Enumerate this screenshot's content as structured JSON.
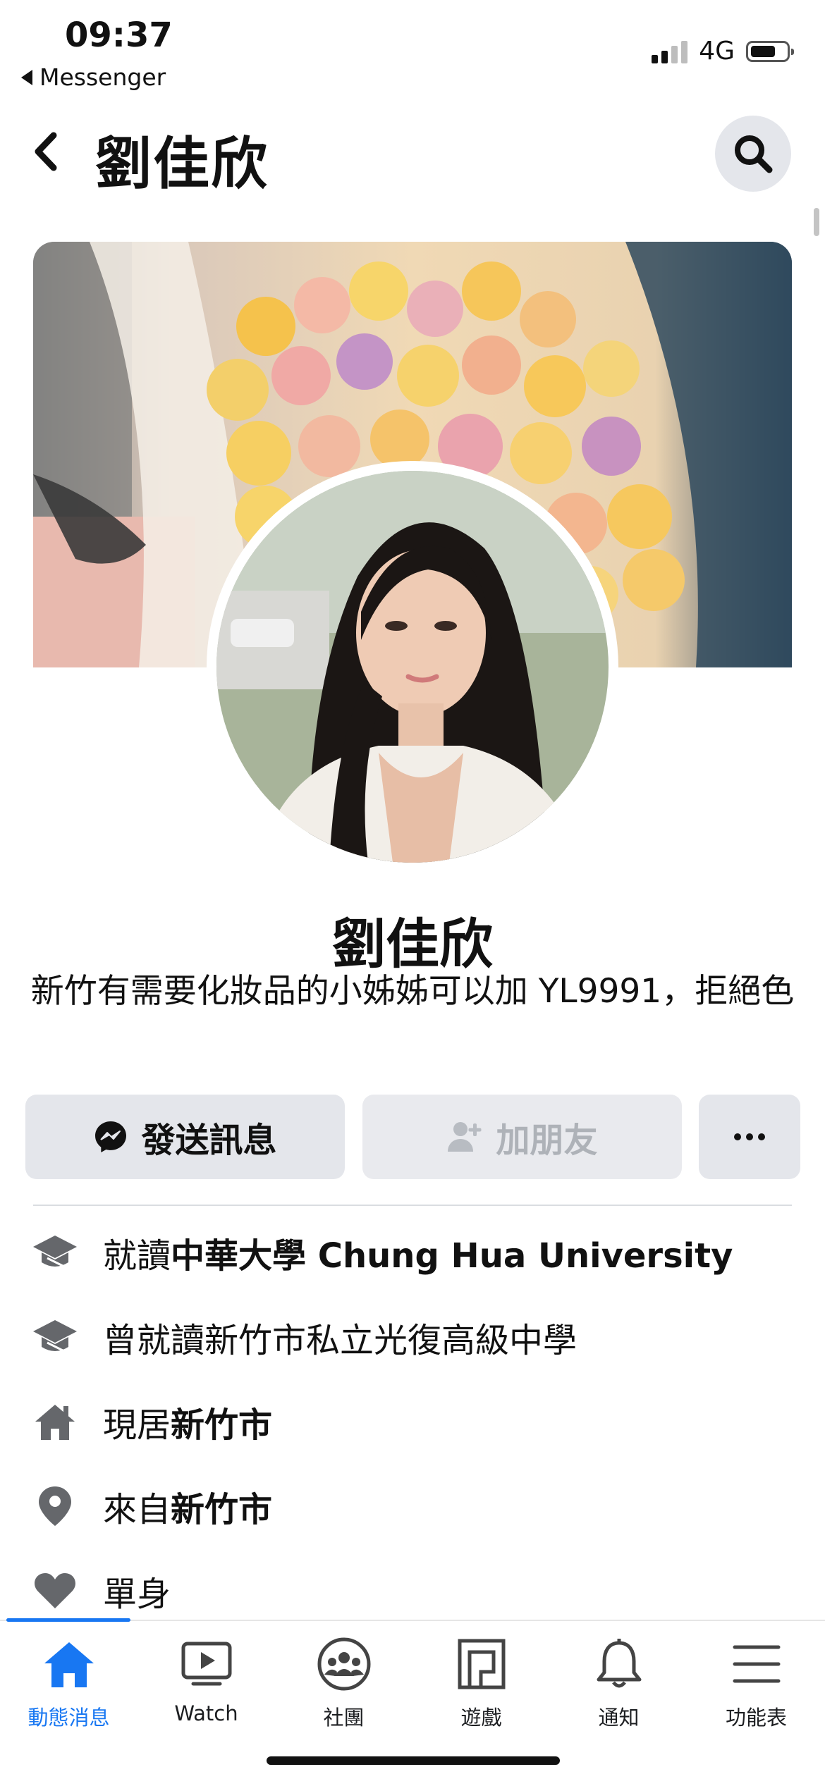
{
  "status_bar": {
    "time": "09:37",
    "back_app": "Messenger",
    "network": "4G",
    "signal_bars": 2,
    "battery_level": 0.65
  },
  "header": {
    "title": "劉佳欣",
    "back_icon": "chevron-left-icon",
    "search_icon": "search-icon"
  },
  "profile": {
    "name": "劉佳欣",
    "bio": "新竹有需要化妝品的小姊姊可以加 YL9991，拒絕色"
  },
  "actions": {
    "message_label": "發送訊息",
    "add_friend_label": "加朋友",
    "more_icon": "more-horizontal-icon"
  },
  "intro": {
    "education_prefix": "就讀",
    "education_school": "中華大學 Chung Hua University",
    "previous_education": "曾就讀新竹市私立光復高級中學",
    "lives_in_prefix": "現居",
    "lives_in_place": "新竹市",
    "from_prefix": "來自",
    "from_place": "新竹市",
    "relationship": "單身"
  },
  "tabs": [
    {
      "label": "動態消息",
      "icon": "home-icon",
      "active": true
    },
    {
      "label": "Watch",
      "icon": "watch-icon",
      "active": false
    },
    {
      "label": "社團",
      "icon": "groups-icon",
      "active": false
    },
    {
      "label": "遊戲",
      "icon": "gaming-icon",
      "active": false
    },
    {
      "label": "通知",
      "icon": "bell-icon",
      "active": false
    },
    {
      "label": "功能表",
      "icon": "menu-icon",
      "active": false
    }
  ],
  "colors": {
    "accent": "#1877f2",
    "button_bg": "#e4e6eb",
    "icon_gray": "#65676b"
  }
}
